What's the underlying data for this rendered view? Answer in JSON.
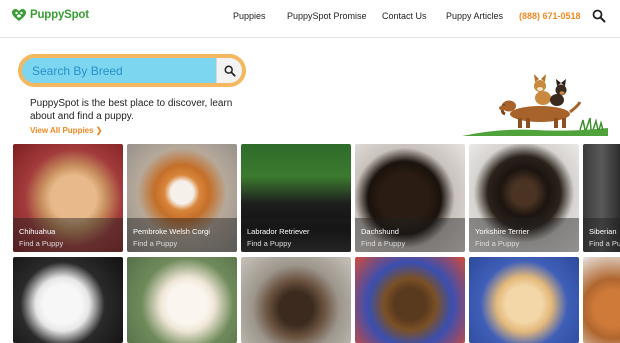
{
  "brand": {
    "name": "PuppySpot",
    "logo_color": "#3a9c35"
  },
  "nav": {
    "items": [
      {
        "label": "Puppies"
      },
      {
        "label": "PuppySpot Promise"
      },
      {
        "label": "Contact Us"
      },
      {
        "label": "Puppy Articles"
      }
    ],
    "phone": "(888) 671-0518",
    "search_icon": "search-icon"
  },
  "hero": {
    "search_placeholder": "Search By Breed",
    "tagline": "PuppySpot is the best place to discover, learn about and find a puppy.",
    "view_all": "View All Puppies ❯"
  },
  "breeds_row1": [
    {
      "name": "Chihuahua",
      "cta": "Find a Puppy"
    },
    {
      "name": "Pembroke Welsh Corgi",
      "cta": "Find a Puppy"
    },
    {
      "name": "Labrador Retriever",
      "cta": "Find a Puppy"
    },
    {
      "name": "Dachshund",
      "cta": "Find a Puppy"
    },
    {
      "name": "Yorkshire Terrier",
      "cta": "Find a Puppy"
    },
    {
      "name": "Siberian",
      "cta": "Find a Puppy"
    }
  ],
  "colors": {
    "accent": "#f08a24",
    "search_field": "#7dd6f0",
    "search_border": "#f3b860"
  }
}
